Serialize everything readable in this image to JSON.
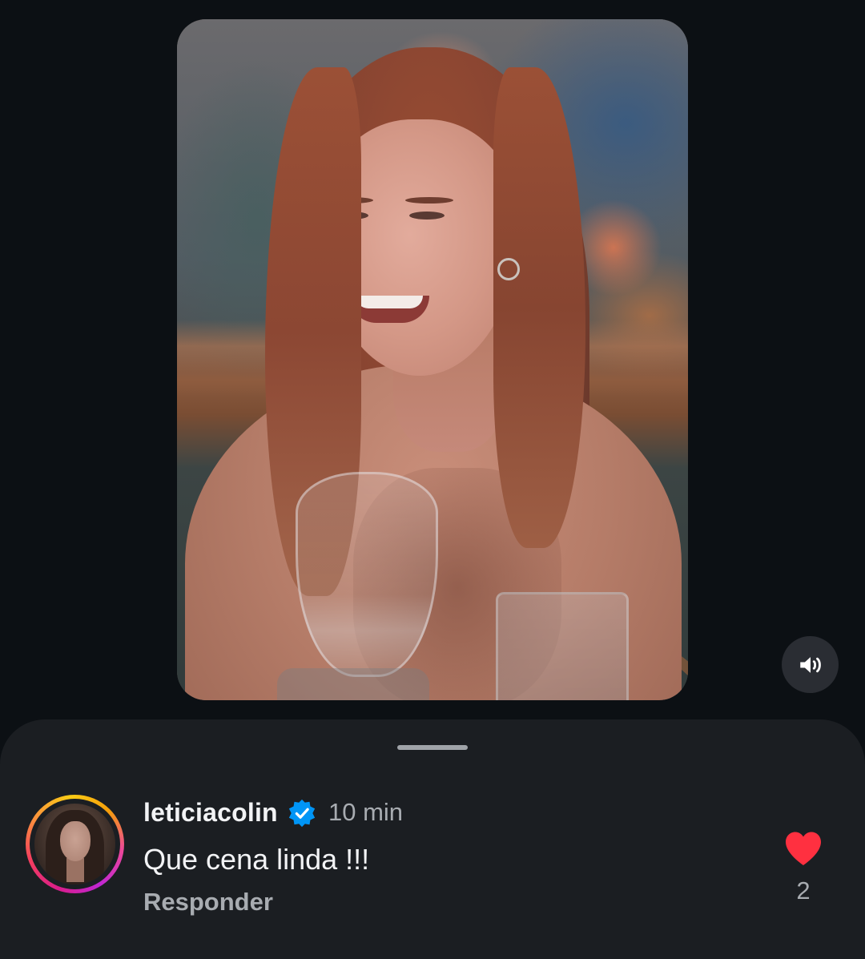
{
  "video": {
    "mute_icon": "speaker-volume-icon"
  },
  "comment": {
    "username": "leticiacolin",
    "verified_icon": "verified-badge-icon",
    "timestamp": "10 min",
    "text": "Que cena linda !!!",
    "reply_label": "Responder",
    "like_icon": "heart-filled-icon",
    "like_count": "2"
  },
  "colors": {
    "background": "#0c1014",
    "sheet": "#1b1e22",
    "like": "#ff3040",
    "verified": "#0095f6",
    "secondary_text": "#a8acb1"
  }
}
